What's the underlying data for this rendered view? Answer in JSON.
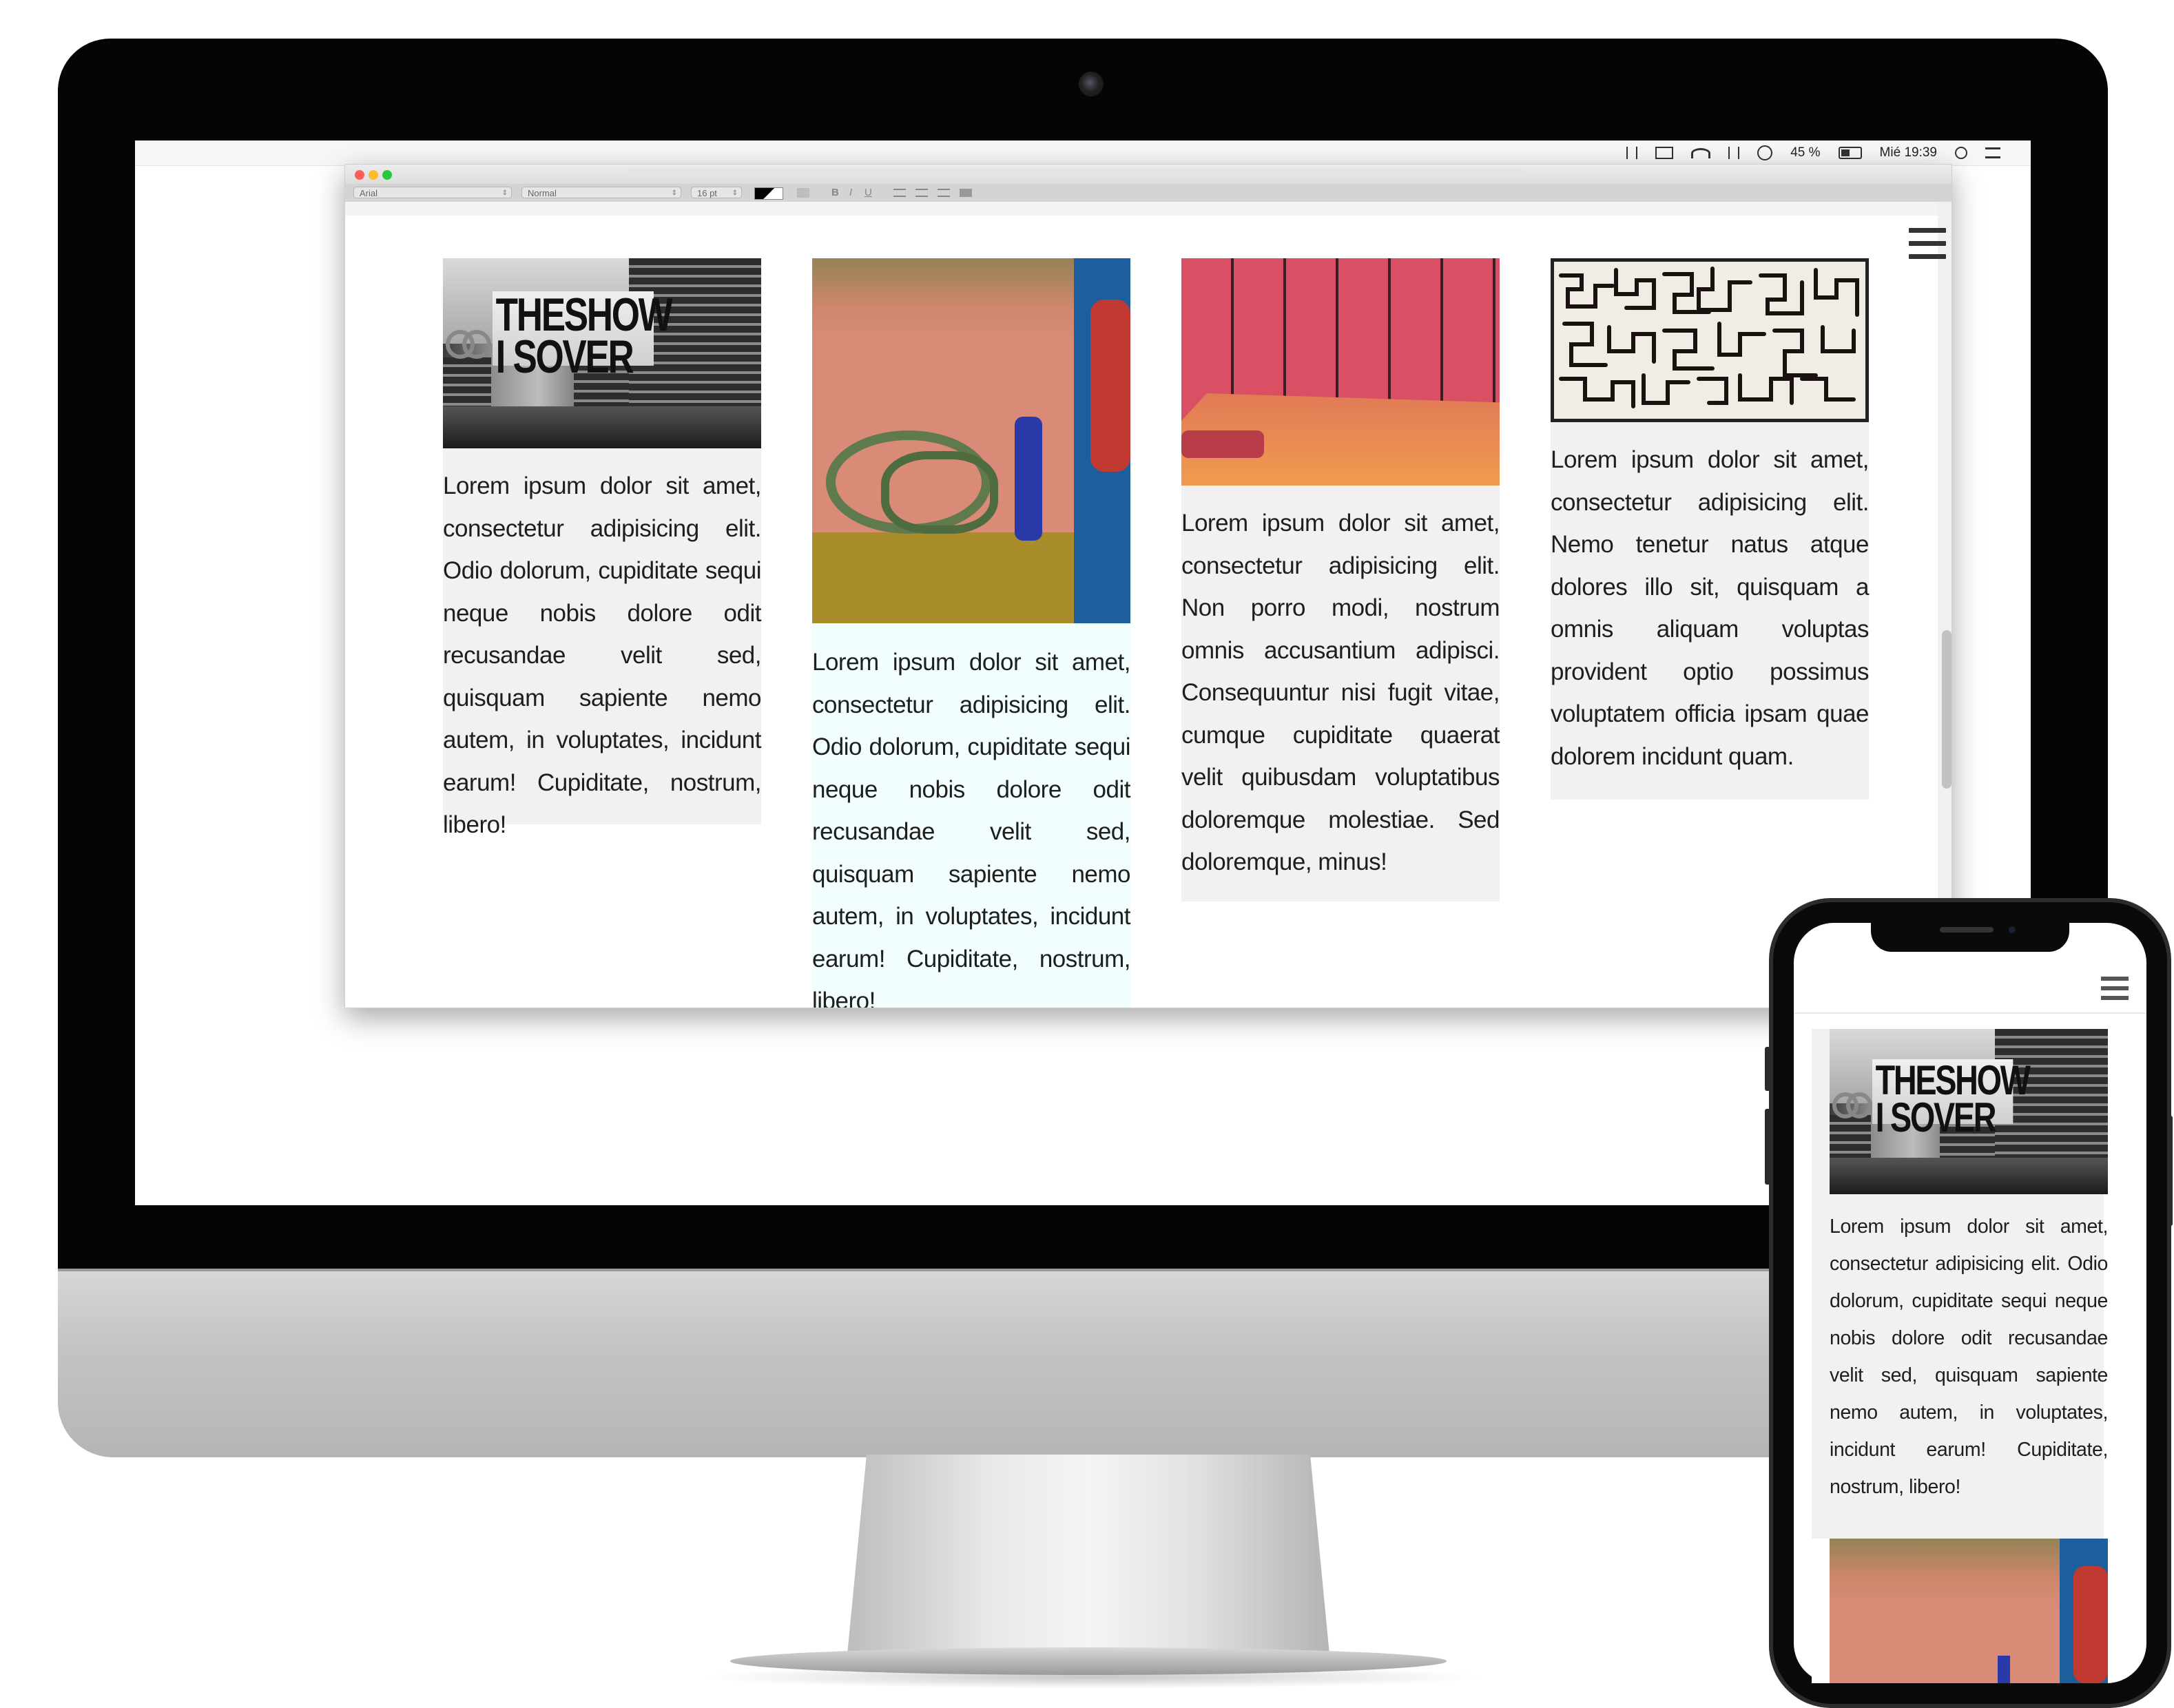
{
  "menubar": {
    "battery": "45 %",
    "clock": "Mié 19:39"
  },
  "formatbar": {
    "font": "Arial",
    "style": "Normal",
    "size": "16 pt",
    "bold": "B",
    "italic": "I",
    "underline": "U"
  },
  "images": {
    "billboard_line1": "THESHOW",
    "billboard_line2": "I SOVER"
  },
  "cards": [
    {
      "text": "Lorem ipsum dolor sit amet, consectetur adipisicing elit. Odio dolorum, cupiditate sequi neque nobis dolore odit recusandae velit sed, quisquam sapiente nemo autem, in voluptates, incidunt earum! Cupiditate, nostrum, libero!"
    },
    {
      "text": "Lorem ipsum dolor sit amet, consectetur adipisicing elit. Odio dolorum, cupiditate sequi neque nobis dolore odit recusandae velit sed, quisquam sapiente nemo autem, in voluptates, incidunt earum! Cupiditate, nostrum, libero!"
    },
    {
      "text": "Lorem ipsum dolor sit amet, consectetur adipisicing elit. Non porro modi, nostrum omnis accusantium adipisci. Consequuntur nisi fugit vitae, cumque cupiditate quaerat velit quibusdam voluptatibus doloremque molestiae. Sed doloremque, minus!"
    },
    {
      "text": "Lorem ipsum dolor sit amet, consectetur adipisicing elit. Nemo tenetur natus atque dolores illo sit, quisquam a omnis aliquam voluptas provident optio possimus voluptatem officia ipsam quae dolorem incidunt quam."
    }
  ],
  "phone": {
    "card_text": "Lorem ipsum dolor sit amet, consectetur adipisicing elit. Odio dolorum, cupiditate sequi neque nobis dolore odit recusandae velit sed, quisquam sapiente nemo autem, in voluptates, incidunt earum! Cupiditate, nostrum, libero!"
  },
  "colors": {
    "card_bg": "#f1f1f1",
    "text": "#1e1e1e",
    "close": "#fc5f57",
    "minimize": "#fdbc2e",
    "maximize": "#28c840"
  },
  "icons": [
    "menu-hamburger-icon",
    "wifi-icon",
    "battery-icon",
    "search-icon",
    "clock-icon",
    "airplay-icon",
    "list-icon"
  ]
}
